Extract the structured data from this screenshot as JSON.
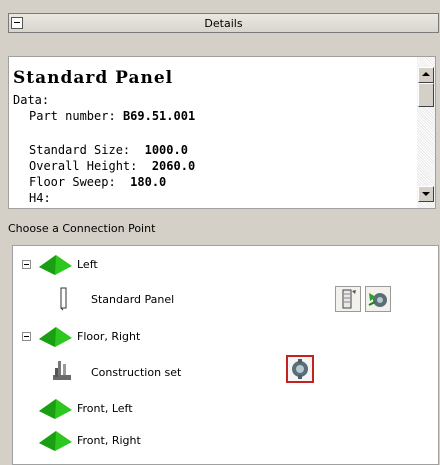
{
  "header": {
    "title": "Details"
  },
  "details": {
    "title": "Standard Panel",
    "data_label": "Data:",
    "fields": [
      {
        "label": "Part number:",
        "value": "B69.51.001"
      },
      {
        "label": "Standard Size:",
        "value": "1000.0"
      },
      {
        "label": "Overall Height:",
        "value": "2060.0"
      },
      {
        "label": "Floor Sweep:",
        "value": "180.0"
      }
    ],
    "cut_line": "H4:"
  },
  "connection_section": {
    "label": "Choose a Connection Point"
  },
  "tree": {
    "items": [
      {
        "label": "Left",
        "icon": "green-pyramid-icon",
        "expanded": true
      },
      {
        "label": "Standard Panel",
        "icon": "panel-icon"
      },
      {
        "label": "Floor, Right",
        "icon": "green-pyramid-icon",
        "expanded": true
      },
      {
        "label": "Construction set",
        "icon": "construction-set-icon"
      },
      {
        "label": "Front, Left",
        "icon": "green-pyramid-icon"
      },
      {
        "label": "Front, Right",
        "icon": "green-pyramid-icon"
      }
    ],
    "actions": [
      {
        "icon": "panel-edit-icon"
      },
      {
        "icon": "connect-gear-icon"
      },
      {
        "icon": "connect-gear-icon",
        "selected": true
      }
    ]
  },
  "colors": {
    "pyramid_green": "#20b818",
    "selection_red": "#c42121",
    "background": "#d4d0c8"
  }
}
